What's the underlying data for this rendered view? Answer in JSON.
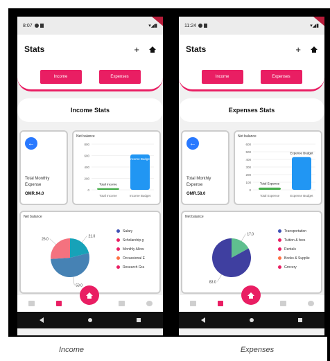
{
  "screens": [
    {
      "status": {
        "time": "8:07"
      },
      "title": "Stats",
      "tabs": [
        "Income",
        "Expenses"
      ],
      "section_title": "Income Stats",
      "summary": {
        "label": "Total Monthly Expense",
        "amount": "OMR.94.0"
      },
      "bar_card": {
        "title": "Net balance",
        "yticks": [
          "800",
          "600",
          "400",
          "200",
          "0"
        ],
        "bar1_label": "Total Income",
        "bar2_label": "Income Budget",
        "xlabels": [
          "Total Income",
          "Income Budget"
        ],
        "bar1_value": 30,
        "bar2_value": 620
      },
      "pie_card": {
        "title": "Net balance",
        "slice_labels": [
          "21.0",
          "53.0",
          "26.0"
        ],
        "legend": [
          "Salary",
          "Scholarship g",
          "Monthly Allow",
          "Occassional E",
          "Research Gra"
        ]
      },
      "caption": "Income"
    },
    {
      "status": {
        "time": "11:24"
      },
      "title": "Stats",
      "tabs": [
        "Income",
        "Expenses"
      ],
      "section_title": "Expenses Stats",
      "summary": {
        "label": "Total Monthly Expense",
        "amount": "OMR.58.0"
      },
      "bar_card": {
        "title": "Net balance",
        "yticks": [
          "600",
          "500",
          "400",
          "300",
          "200",
          "100",
          "0"
        ],
        "bar1_label": "Total Expense",
        "bar2_label": "Expense Budget",
        "xlabels": [
          "Total Expense",
          "Expense Budget"
        ],
        "bar1_value": 30,
        "bar2_value": 430
      },
      "pie_card": {
        "title": "Net balance",
        "slice_labels": [
          "17.0",
          "83.0"
        ],
        "legend": [
          "Transportation",
          "Tuition & fees",
          "Rentals",
          "Books & Supplie",
          "Grocery"
        ]
      },
      "caption": "Expenses"
    }
  ],
  "colors": {
    "accent": "#e91e63",
    "blue": "#2196f3",
    "green": "#4caf50"
  }
}
